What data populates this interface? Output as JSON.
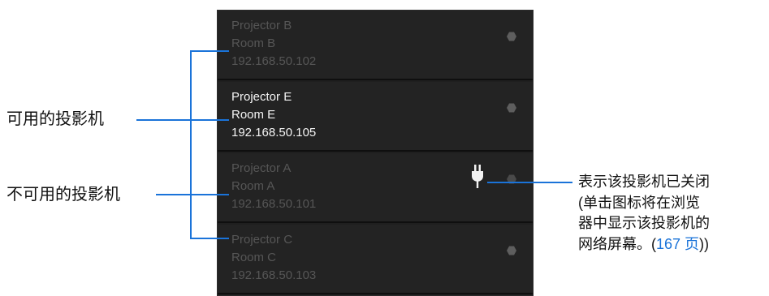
{
  "projectors": [
    {
      "name": "Projector B",
      "room": "Room B",
      "ip": "192.168.50.102",
      "state": "unavailable"
    },
    {
      "name": "Projector E",
      "room": "Room E",
      "ip": "192.168.50.105",
      "state": "available"
    },
    {
      "name": "Projector A",
      "room": "Room A",
      "ip": "192.168.50.101",
      "state": "unavailable",
      "icon": "plug-icon"
    },
    {
      "name": "Projector C",
      "room": "Room C",
      "ip": "192.168.50.103",
      "state": "unavailable"
    }
  ],
  "callouts": {
    "available": "可用的投影机",
    "unavailable": "不可用的投影机",
    "note_line1": "表示该投影机已关闭",
    "note_line2": "(单击图标将在浏览",
    "note_line3": "器中显示该投影机的",
    "note_line4_prefix": "网络屏幕。(",
    "note_page_link": "167 页",
    "note_line4_suffix": "))"
  },
  "colors": {
    "panel_bg": "#232323",
    "text_available": "#f4f4f4",
    "text_unavailable": "#565656",
    "callout_line": "#1a73d9"
  }
}
